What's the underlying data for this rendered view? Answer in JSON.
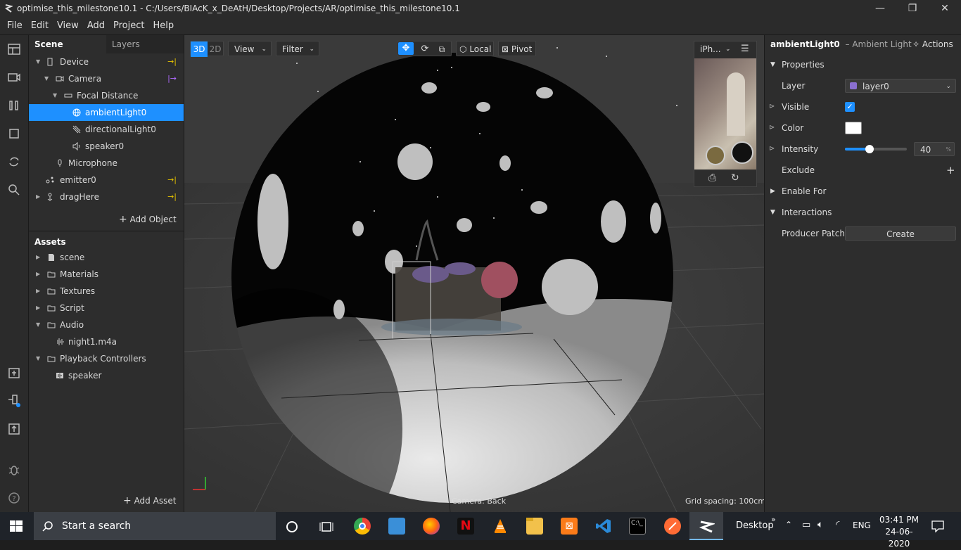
{
  "window": {
    "title": "optimise_this_milestone10.1 - C:/Users/BIAcK_x_DeAtH/Desktop/Projects/AR/optimise_this_milestone10.1",
    "minimize": "—",
    "maximize": "❐",
    "close": "✕"
  },
  "menu": [
    "File",
    "Edit",
    "View",
    "Add",
    "Project",
    "Help"
  ],
  "scene_panel": {
    "tab_scene": "Scene",
    "tab_layers": "Layers",
    "items": [
      {
        "label": "Device",
        "icon": "device-icon"
      },
      {
        "label": "Camera",
        "icon": "camera-icon"
      },
      {
        "label": "Focal Distance",
        "icon": "focal-distance-icon"
      },
      {
        "label": "ambientLight0",
        "icon": "ambient-light-icon"
      },
      {
        "label": "directionalLight0",
        "icon": "directional-light-icon"
      },
      {
        "label": "speaker0",
        "icon": "speaker-icon"
      },
      {
        "label": "Microphone",
        "icon": "microphone-icon"
      },
      {
        "label": "emitter0",
        "icon": "emitter-icon"
      },
      {
        "label": "dragHere",
        "icon": "drag-icon"
      }
    ],
    "add_object": "Add Object"
  },
  "assets_panel": {
    "title": "Assets",
    "items": [
      {
        "label": "scene"
      },
      {
        "label": "Materials"
      },
      {
        "label": "Textures"
      },
      {
        "label": "Script"
      },
      {
        "label": "Audio"
      },
      {
        "label": "night1.m4a"
      },
      {
        "label": "Playback Controllers"
      },
      {
        "label": "speaker"
      }
    ],
    "add_asset": "Add Asset"
  },
  "viewport": {
    "mode_3d": "3D",
    "mode_2d": "2D",
    "view_label": "View",
    "filter_label": "Filter",
    "local_label": "Local",
    "pivot_label": "Pivot",
    "device_label": "iPh...",
    "camera_label": "Camera: Back",
    "grid_label": "Grid spacing: 100cm"
  },
  "inspector": {
    "object_name": "ambientLight0",
    "object_type": "– Ambient Light",
    "actions": "Actions",
    "properties_header": "Properties",
    "layer_label": "Layer",
    "layer_value": "layer0",
    "layer_color": "#8a6fd1",
    "visible_label": "Visible",
    "visible_checked": true,
    "color_label": "Color",
    "color_value": "#ffffff",
    "intensity_label": "Intensity",
    "intensity_value": "40",
    "intensity_unit": "%",
    "intensity_fraction": 0.4,
    "exclude_label": "Exclude",
    "enable_for_label": "Enable For",
    "interactions_header": "Interactions",
    "producer_patch_label": "Producer Patch",
    "create_label": "Create"
  },
  "taskbar": {
    "search_placeholder": "Start a search",
    "desktop_label": "Desktop",
    "lang": "ENG",
    "time": "03:41 PM",
    "date": "24-06-2020"
  },
  "colors": {
    "accent": "#1e90ff",
    "selection": "#1e90ff",
    "warning_arrow": "#e6c200",
    "camera_arrow": "#b06bff"
  }
}
